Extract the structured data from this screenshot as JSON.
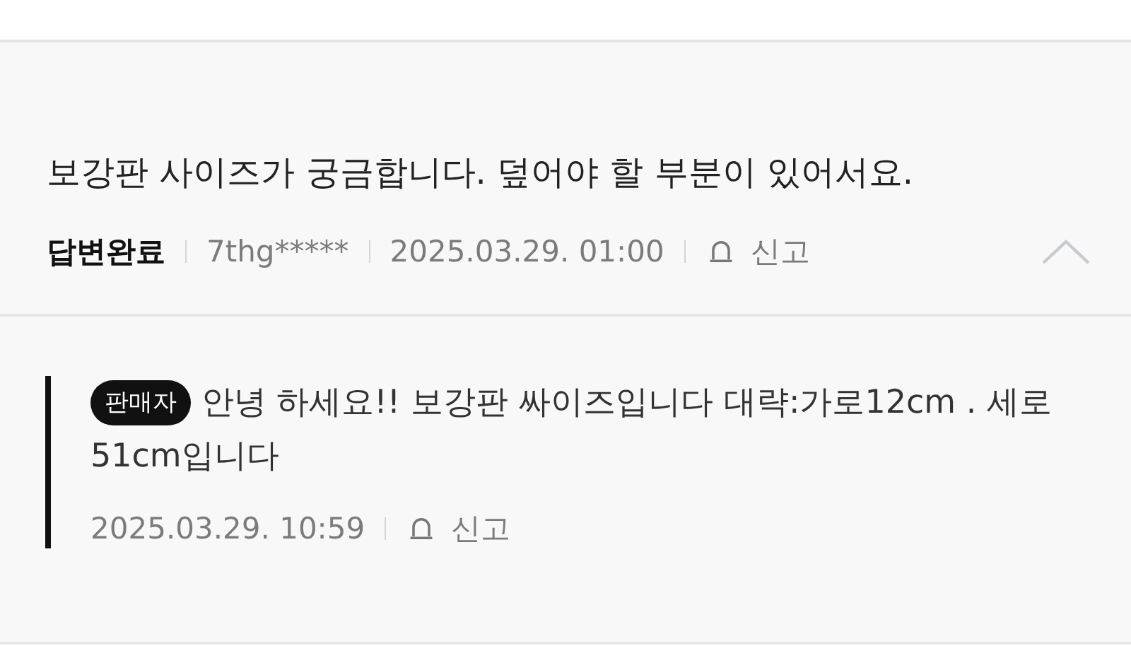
{
  "question": {
    "text": "보강판 사이즈가 궁금합니다. 덮어야 할 부분이 있어서요.",
    "status": "답변완료",
    "author": "7thg*****",
    "date": "2025.03.29. 01:00",
    "report": "신고",
    "expanded": true
  },
  "reply": {
    "badge": "판매자",
    "text": "안녕 하세요!! 보강판 싸이즈입니다 대략:가로12cm . 세로51cm입니다",
    "date": "2025.03.29. 10:59",
    "report": "신고"
  }
}
